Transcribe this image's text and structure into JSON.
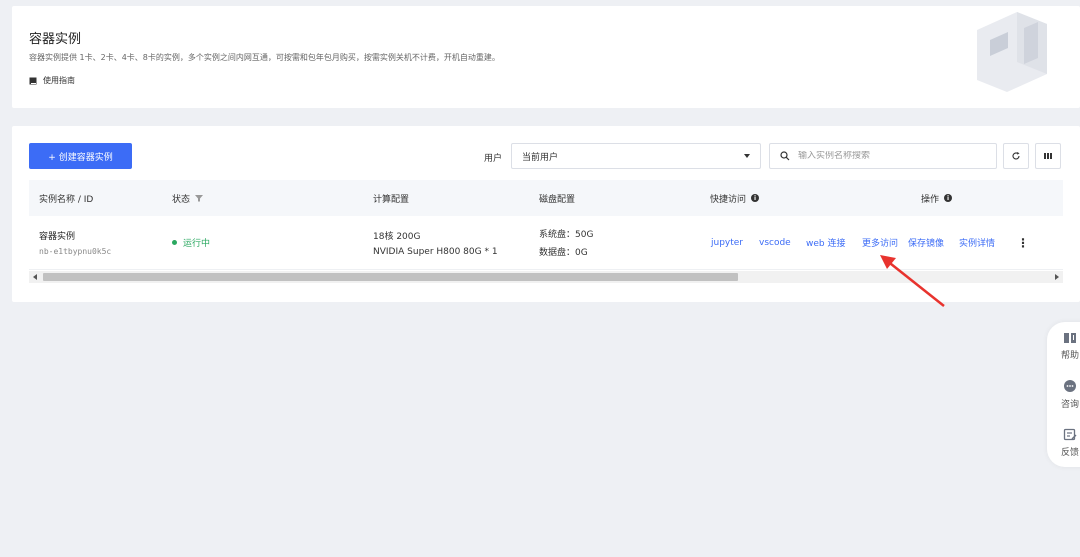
{
  "header": {
    "title": "容器实例",
    "description": "容器实例提供 1卡、2卡、4卡、8卡的实例，多个实例之间内网互通，可按需和包年包月购买，按需实例关机不计费，开机自动重建。",
    "guide_label": "使用指南"
  },
  "toolbar": {
    "create_label": "+ 创建容器实例",
    "user_label": "用户",
    "user_select_value": "当前用户",
    "search_placeholder": "输入实例名称搜索"
  },
  "table": {
    "headers": {
      "name": "实例名称 / ID",
      "status": "状态",
      "compute": "计算配置",
      "disk": "磁盘配置",
      "quick_access": "快捷访问",
      "actions": "操作"
    },
    "rows": [
      {
        "name": "容器实例",
        "id": "nb-e1tbypnu0k5c",
        "status": "运行中",
        "compute_line1": "18核 200G",
        "compute_line2": "NVIDIA Super H800 80G * 1",
        "disk_line1": "系统盘：50G",
        "disk_line2": "数据盘：0G",
        "quick_links": [
          "jupyter",
          "vscode",
          "web 连接",
          "更多访问"
        ],
        "actions": [
          "保存镜像",
          "实例详情"
        ],
        "more": "⋮"
      }
    ]
  },
  "float_bar": {
    "items": [
      {
        "label": "帮助",
        "icon": "help-book-icon"
      },
      {
        "label": "咨询",
        "icon": "chat-bubble-icon"
      },
      {
        "label": "反馈",
        "icon": "feedback-icon"
      }
    ]
  },
  "colors": {
    "primary": "#3c6cf6",
    "running": "#2aa860",
    "annotation_arrow": "#e8332e"
  }
}
